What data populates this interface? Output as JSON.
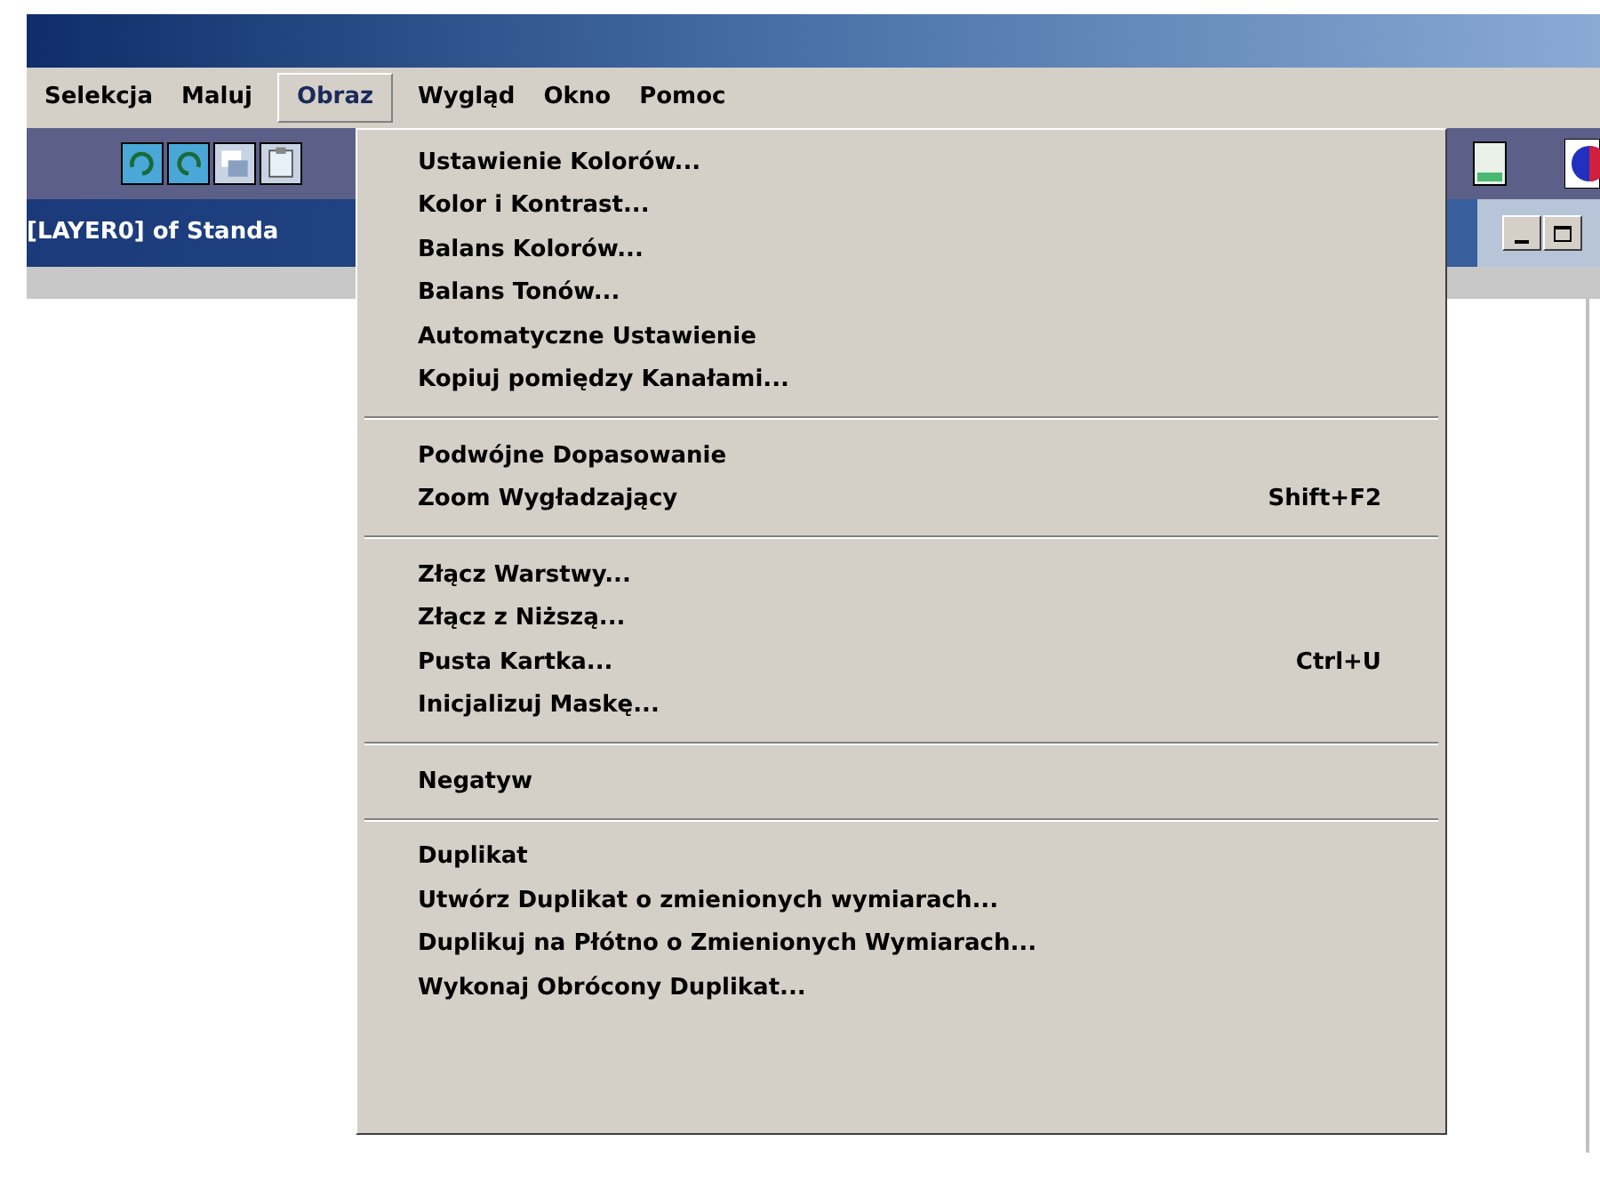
{
  "menu_bar": [
    {
      "label": "Selekcja",
      "selected": false
    },
    {
      "label": "Maluj",
      "selected": false
    },
    {
      "label": "Obraz",
      "selected": true
    },
    {
      "label": "Wygląd",
      "selected": false
    },
    {
      "label": "Okno",
      "selected": false
    },
    {
      "label": "Pomoc",
      "selected": false
    }
  ],
  "document": {
    "title": "[LAYER0] of Standa"
  },
  "menu": [
    {
      "kind": "item",
      "label": "Ustawienie Kolorów..."
    },
    {
      "kind": "item",
      "label": "Kolor i Kontrast..."
    },
    {
      "kind": "item",
      "label": "Balans Kolorów..."
    },
    {
      "kind": "item",
      "label": "Balans Tonów..."
    },
    {
      "kind": "item",
      "label": "Automatyczne Ustawienie"
    },
    {
      "kind": "item",
      "label": "Kopiuj pomiędzy Kanałami..."
    },
    {
      "kind": "separator"
    },
    {
      "kind": "item",
      "label": "Podwójne Dopasowanie"
    },
    {
      "kind": "item",
      "label": "Zoom Wygładzający",
      "shortcut": "Shift+F2"
    },
    {
      "kind": "separator"
    },
    {
      "kind": "item",
      "label": "Złącz Warstwy..."
    },
    {
      "kind": "item",
      "label": "Złącz z Niższą..."
    },
    {
      "kind": "item",
      "label": "Pusta Kartka...",
      "shortcut": "Ctrl+U"
    },
    {
      "kind": "item",
      "label": "Inicjalizuj Maskę..."
    },
    {
      "kind": "separator"
    },
    {
      "kind": "item",
      "label": "Negatyw"
    },
    {
      "kind": "separator"
    },
    {
      "kind": "item",
      "label": "Duplikat"
    },
    {
      "kind": "item",
      "label": "Utwórz Duplikat o zmienionych wymiarach..."
    },
    {
      "kind": "item",
      "label": "Duplikuj na Płótno o Zmienionych Wymiarach..."
    },
    {
      "kind": "item",
      "label": "Wykonaj Obrócony Duplikat..."
    }
  ]
}
